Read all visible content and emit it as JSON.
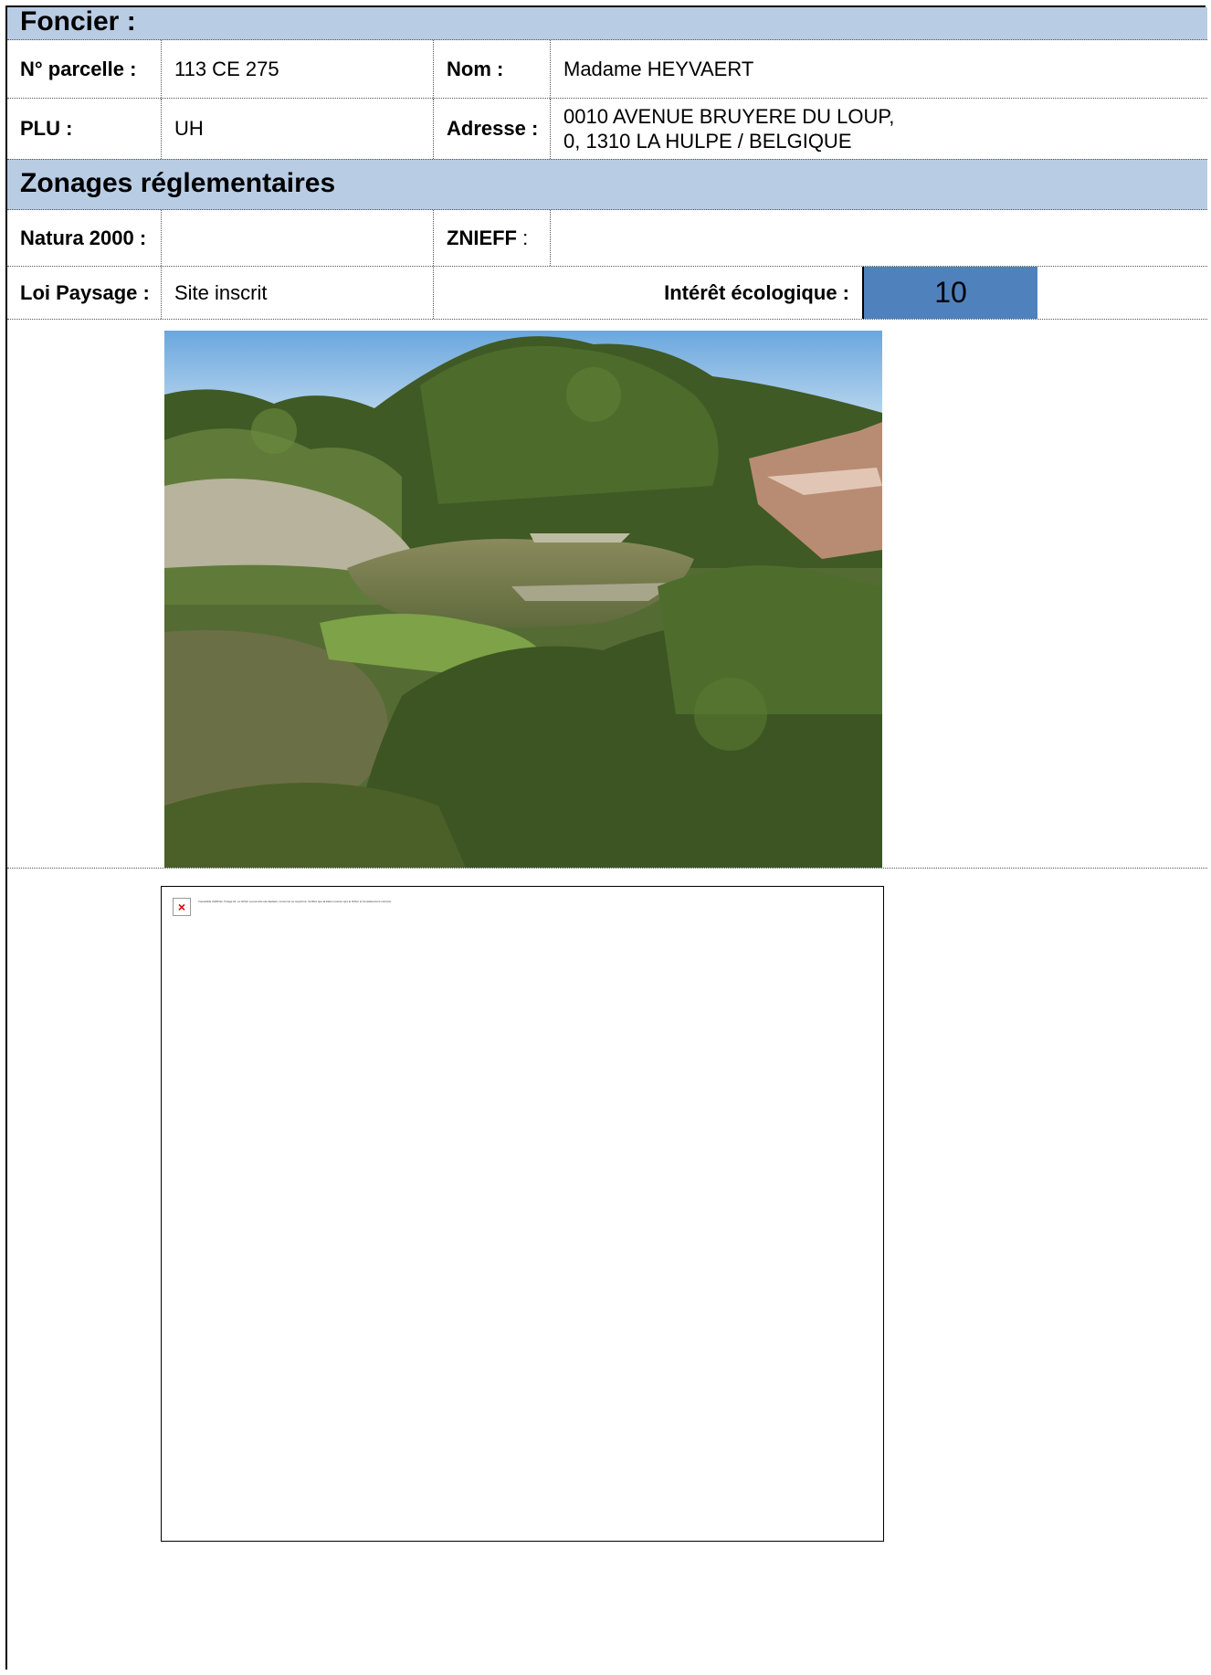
{
  "foncier": {
    "title": "Foncier :",
    "parcelle_label": "N° parcelle :",
    "parcelle_value": "113 CE 275",
    "nom_label": "Nom :",
    "nom_value": "Madame HEYVAERT",
    "plu_label": "PLU :",
    "plu_value": "UH",
    "adresse_label": "Adresse :",
    "adresse_line1": "0010 AVENUE BRUYERE DU LOUP,",
    "adresse_line2": "0, 1310 LA HULPE / BELGIQUE"
  },
  "zonages": {
    "title": "Zonages réglementaires",
    "natura_label": "Natura 2000 :",
    "natura_value": "",
    "znieff_label": "ZNIEFF",
    "znieff_colon": " :",
    "znieff_value": "",
    "loi_label": "Loi Paysage :",
    "loi_value": "Site inscrit",
    "interet_label": "Intérêt écologique :",
    "interet_value": "10"
  },
  "media": {
    "photo_icon": "site-photo",
    "broken_image_icon": "broken-image-icon",
    "broken_image_message": "Impossible d'afficher l'image lié. Le fichier a peut-être été déplacé, renommé ou supprimé. Vérifiez que la liaison pointe vers le fichier et l'emplacement corrects."
  }
}
